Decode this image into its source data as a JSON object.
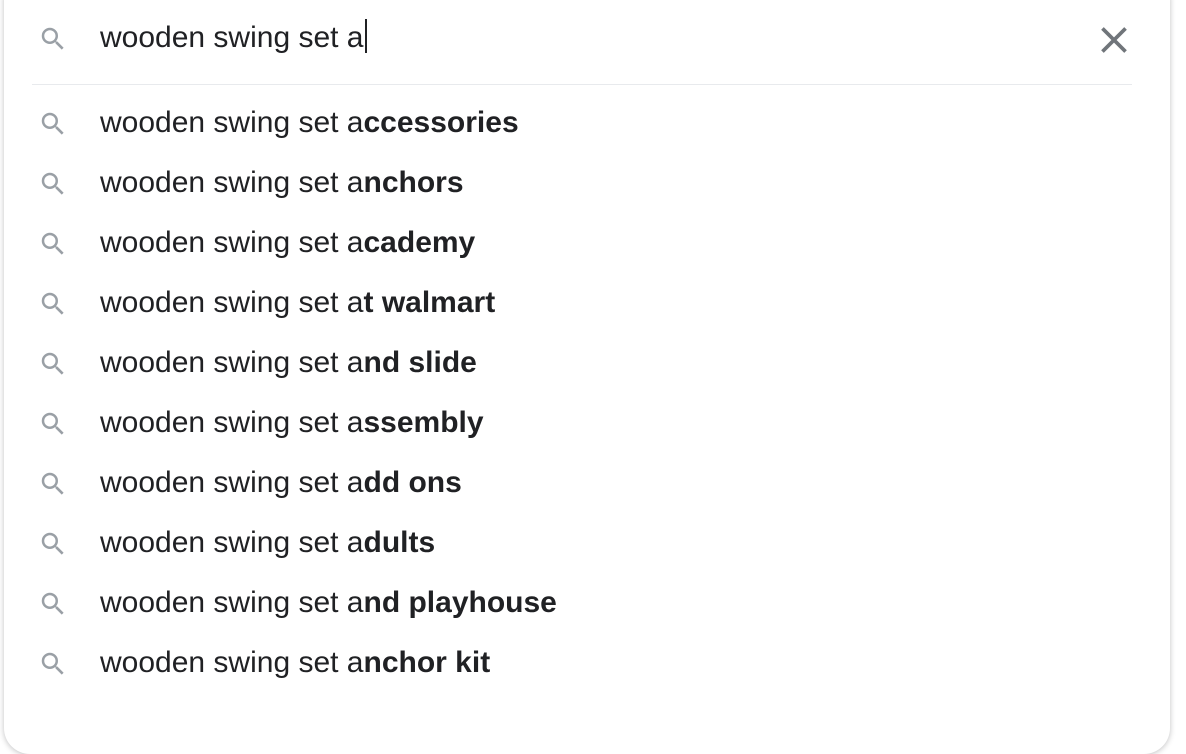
{
  "search": {
    "query": "wooden swing set a",
    "icon": "search-icon",
    "clear_icon": "close-icon"
  },
  "suggestions": [
    {
      "prefix": "wooden swing set a",
      "completion": "ccessories"
    },
    {
      "prefix": "wooden swing set a",
      "completion": "nchors"
    },
    {
      "prefix": "wooden swing set a",
      "completion": "cademy"
    },
    {
      "prefix": "wooden swing set a",
      "completion": "t walmart"
    },
    {
      "prefix": "wooden swing set a",
      "completion": "nd slide"
    },
    {
      "prefix": "wooden swing set a",
      "completion": "ssembly"
    },
    {
      "prefix": "wooden swing set a",
      "completion": "dd ons"
    },
    {
      "prefix": "wooden swing set a",
      "completion": "dults"
    },
    {
      "prefix": "wooden swing set a",
      "completion": "nd playhouse"
    },
    {
      "prefix": "wooden swing set a",
      "completion": "nchor kit"
    }
  ],
  "colors": {
    "text": "#202124",
    "icon": "#9aa0a6",
    "close_icon": "#70757a",
    "divider": "#e8eaed"
  }
}
